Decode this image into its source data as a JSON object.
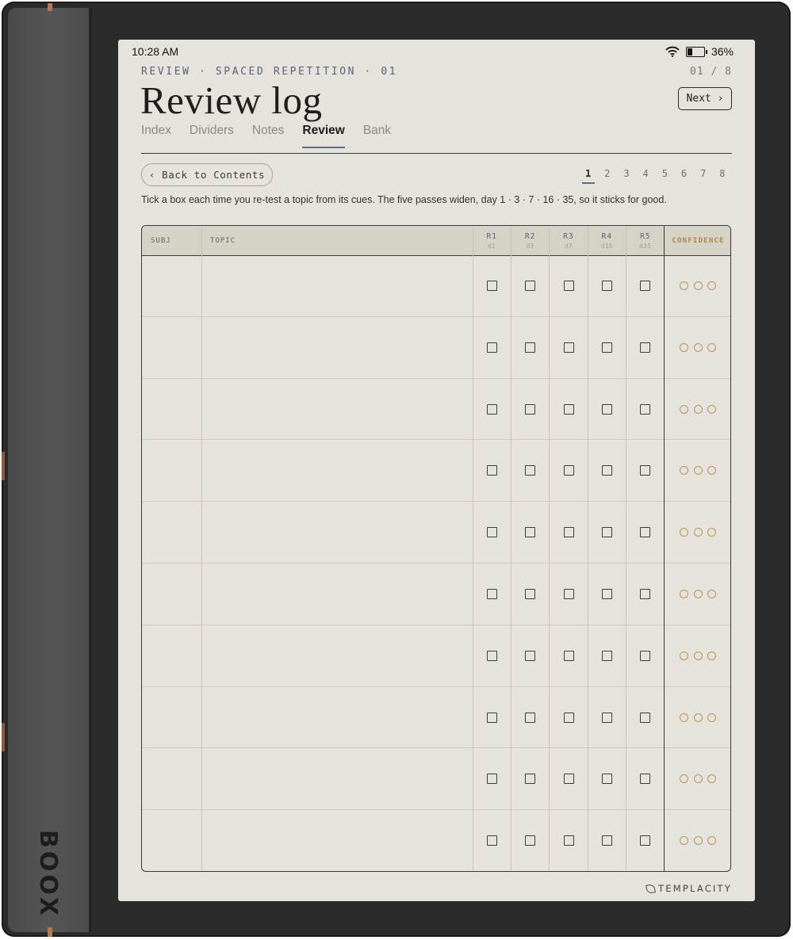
{
  "device": {
    "brand": "BOOX"
  },
  "status_bar": {
    "time": "10:28 AM",
    "battery": "36%",
    "battery_level": 0.36
  },
  "header": {
    "eyebrow": "REVIEW · SPACED REPETITION · 01",
    "page_count": "01 / 8",
    "title": "Review log",
    "next_label": "Next ›"
  },
  "tabs": [
    {
      "label": "Index",
      "active": false
    },
    {
      "label": "Dividers",
      "active": false
    },
    {
      "label": "Notes",
      "active": false
    },
    {
      "label": "Review",
      "active": true
    },
    {
      "label": "Bank",
      "active": false
    }
  ],
  "back_label": "‹ Back to Contents",
  "pager": {
    "pages": [
      "1",
      "2",
      "3",
      "4",
      "5",
      "6",
      "7",
      "8"
    ],
    "current": "1"
  },
  "intro": "Tick a box each time you re-test a topic from its cues. The five passes widen, day 1 · 3 · 7 · 16 · 35, so it sticks for good.",
  "table": {
    "headers": {
      "subj": "SUBJ",
      "topic": "TOPIC",
      "rounds": [
        {
          "label": "R1",
          "day": "d1"
        },
        {
          "label": "R2",
          "day": "d3"
        },
        {
          "label": "R3",
          "day": "d7"
        },
        {
          "label": "R4",
          "day": "d16"
        },
        {
          "label": "R5",
          "day": "d35"
        }
      ],
      "confidence": "CONFIDENCE"
    },
    "row_count": 10,
    "confidence_dots": 3
  },
  "footer_brand": "TEMPLACITY",
  "colors": {
    "accent": "#5b6c8f",
    "confidence": "#b48748",
    "paper": "#e6e3dc"
  }
}
